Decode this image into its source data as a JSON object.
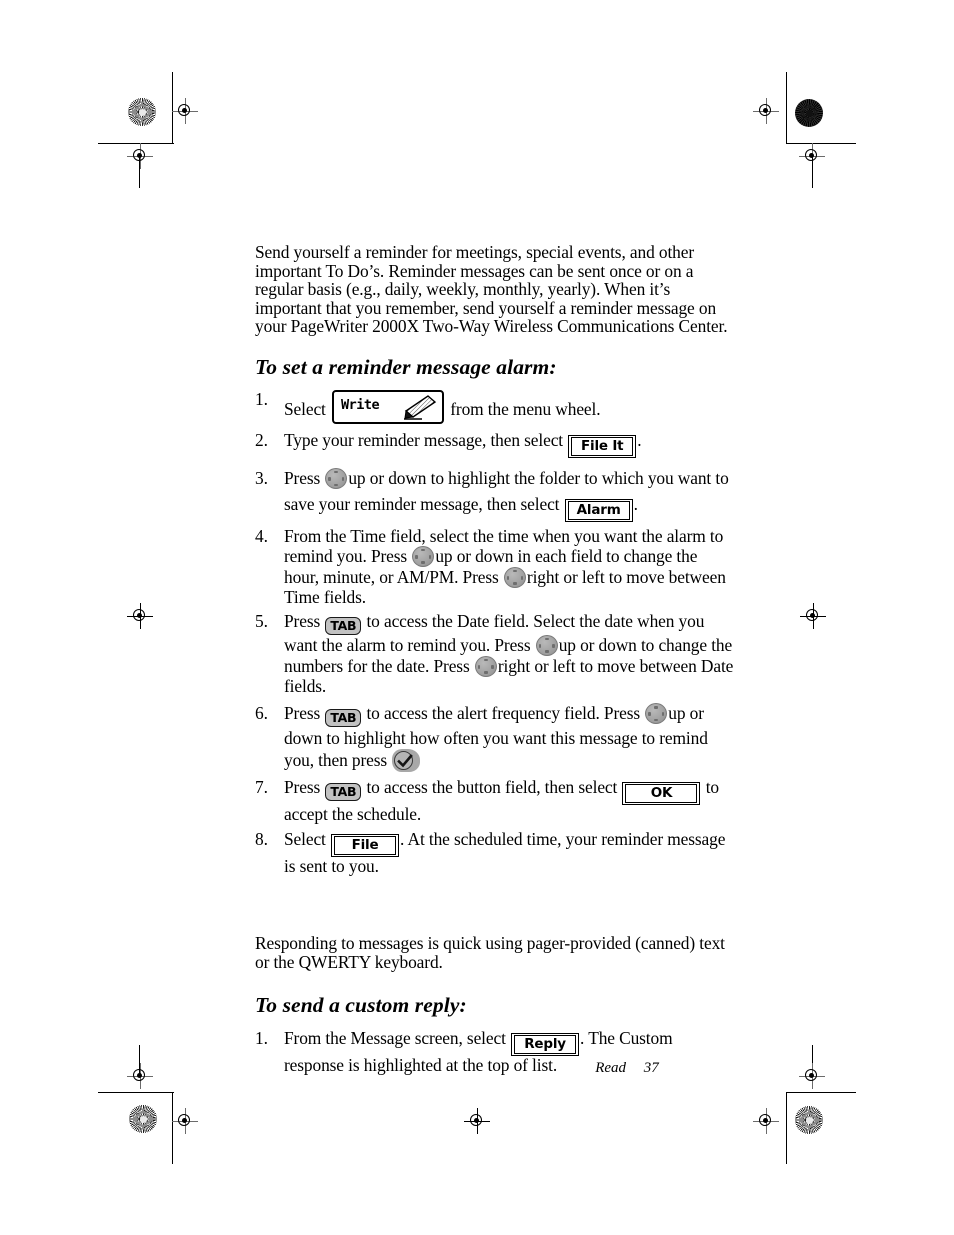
{
  "page": {
    "footer_label": "Read",
    "footer_page_number": "37"
  },
  "intro": {
    "paragraph": "Send yourself a reminder for meetings, special events, and other important To Do’s. Reminder messages can be sent once or on a regular basis (e.g., daily, weekly, monthly, yearly). When it’s important that you remember, send yourself a reminder message on your PageWriter 2000X Two-Way Wireless Communications Center."
  },
  "section_alarm": {
    "heading": "To set a reminder message alarm:",
    "steps": [
      {
        "num": "1.",
        "text_before": "Select",
        "button": "Write",
        "text_after": "from the menu wheel."
      },
      {
        "num": "2.",
        "text_before": "Type your reminder message, then select",
        "button": "File It",
        "text_after": "."
      },
      {
        "num": "3.",
        "text_before": "Press",
        "icon": "dpad-icon",
        "text_mid": "up or down to highlight the folder to which you want to save your reminder message, then select",
        "button": "Alarm",
        "text_after": "."
      },
      {
        "num": "4.",
        "text_a": "From the Time field, select the time when you want the alarm to remind you. Press",
        "icon1": "dpad-icon",
        "text_b": "up or down in each field to change the hour, minute, or AM/PM. Press",
        "icon2": "dpad-icon",
        "text_c": "right or left to move between Time fields."
      },
      {
        "num": "5.",
        "text_a": "Press",
        "key": "TAB",
        "text_b": "to access the Date field. Select the date when you want the alarm to remind you. Press",
        "icon1": "dpad-icon",
        "text_c": "up or down to change the numbers for the date. Press",
        "icon2": "dpad-icon",
        "text_d": "right or left to move between Date fields."
      },
      {
        "num": "6.",
        "text_a": "Press",
        "key": "TAB",
        "text_b": "to access the alert frequency field. Press",
        "icon1": "dpad-icon",
        "text_c": "up or down to highlight how often you want this message to remind you, then press",
        "icon2": "check-key-icon"
      },
      {
        "num": "7.",
        "text_a": "Press",
        "key": "TAB",
        "text_b": "to access the button field, then select",
        "button": "OK",
        "text_c": "to accept the schedule."
      },
      {
        "num": "8.",
        "text_a": "Select",
        "button": "File",
        "text_b": ". At the scheduled time, your reminder message is sent to you."
      }
    ]
  },
  "section_reply": {
    "paragraph": "Responding to messages is quick using pager-provided (canned) text or the QWERTY keyboard.",
    "heading": "To send a custom reply:",
    "steps": [
      {
        "num": "1.",
        "text_a": "From the Message screen, select",
        "button": "Reply",
        "text_b": ". The Custom response is highlighted at the top of list."
      }
    ]
  }
}
